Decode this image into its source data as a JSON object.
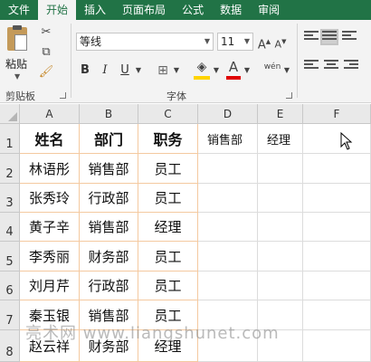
{
  "menu": {
    "tabs": [
      {
        "label": "文件",
        "active": false
      },
      {
        "label": "开始",
        "active": true
      },
      {
        "label": "插入",
        "active": false
      },
      {
        "label": "页面布局",
        "active": false
      },
      {
        "label": "公式",
        "active": false
      },
      {
        "label": "数据",
        "active": false
      },
      {
        "label": "审阅",
        "active": false
      }
    ]
  },
  "ribbon": {
    "clipboard": {
      "paste_label": "粘贴",
      "group_label": "剪贴板"
    },
    "font": {
      "font_name": "等线",
      "font_size": "11",
      "bold": "B",
      "italic": "I",
      "underline": "U",
      "group_label": "字体",
      "phonetic": "wén",
      "grow": "A",
      "shrink": "A",
      "font_color_letter": "A"
    },
    "colors": {
      "accent": "#217346",
      "highlight": "#ffd400",
      "font_color": "#e00000"
    }
  },
  "sheet": {
    "columns": [
      "A",
      "B",
      "C",
      "D",
      "E",
      "F"
    ],
    "rows": [
      "1",
      "2",
      "3",
      "4",
      "5",
      "6",
      "7",
      "8"
    ],
    "table": {
      "headers": [
        "姓名",
        "部门",
        "职务"
      ],
      "data": [
        [
          "林语彤",
          "销售部",
          "员工"
        ],
        [
          "张秀玲",
          "行政部",
          "员工"
        ],
        [
          "黄子辛",
          "销售部",
          "经理"
        ],
        [
          "李秀丽",
          "财务部",
          "员工"
        ],
        [
          "刘月芹",
          "行政部",
          "员工"
        ],
        [
          "秦玉银",
          "销售部",
          "员工"
        ],
        [
          "赵云祥",
          "财务部",
          "经理"
        ]
      ]
    },
    "criteria": {
      "d1": "销售部",
      "e1": "经理"
    }
  },
  "watermark": "亮术网 www.liangshunet.com"
}
